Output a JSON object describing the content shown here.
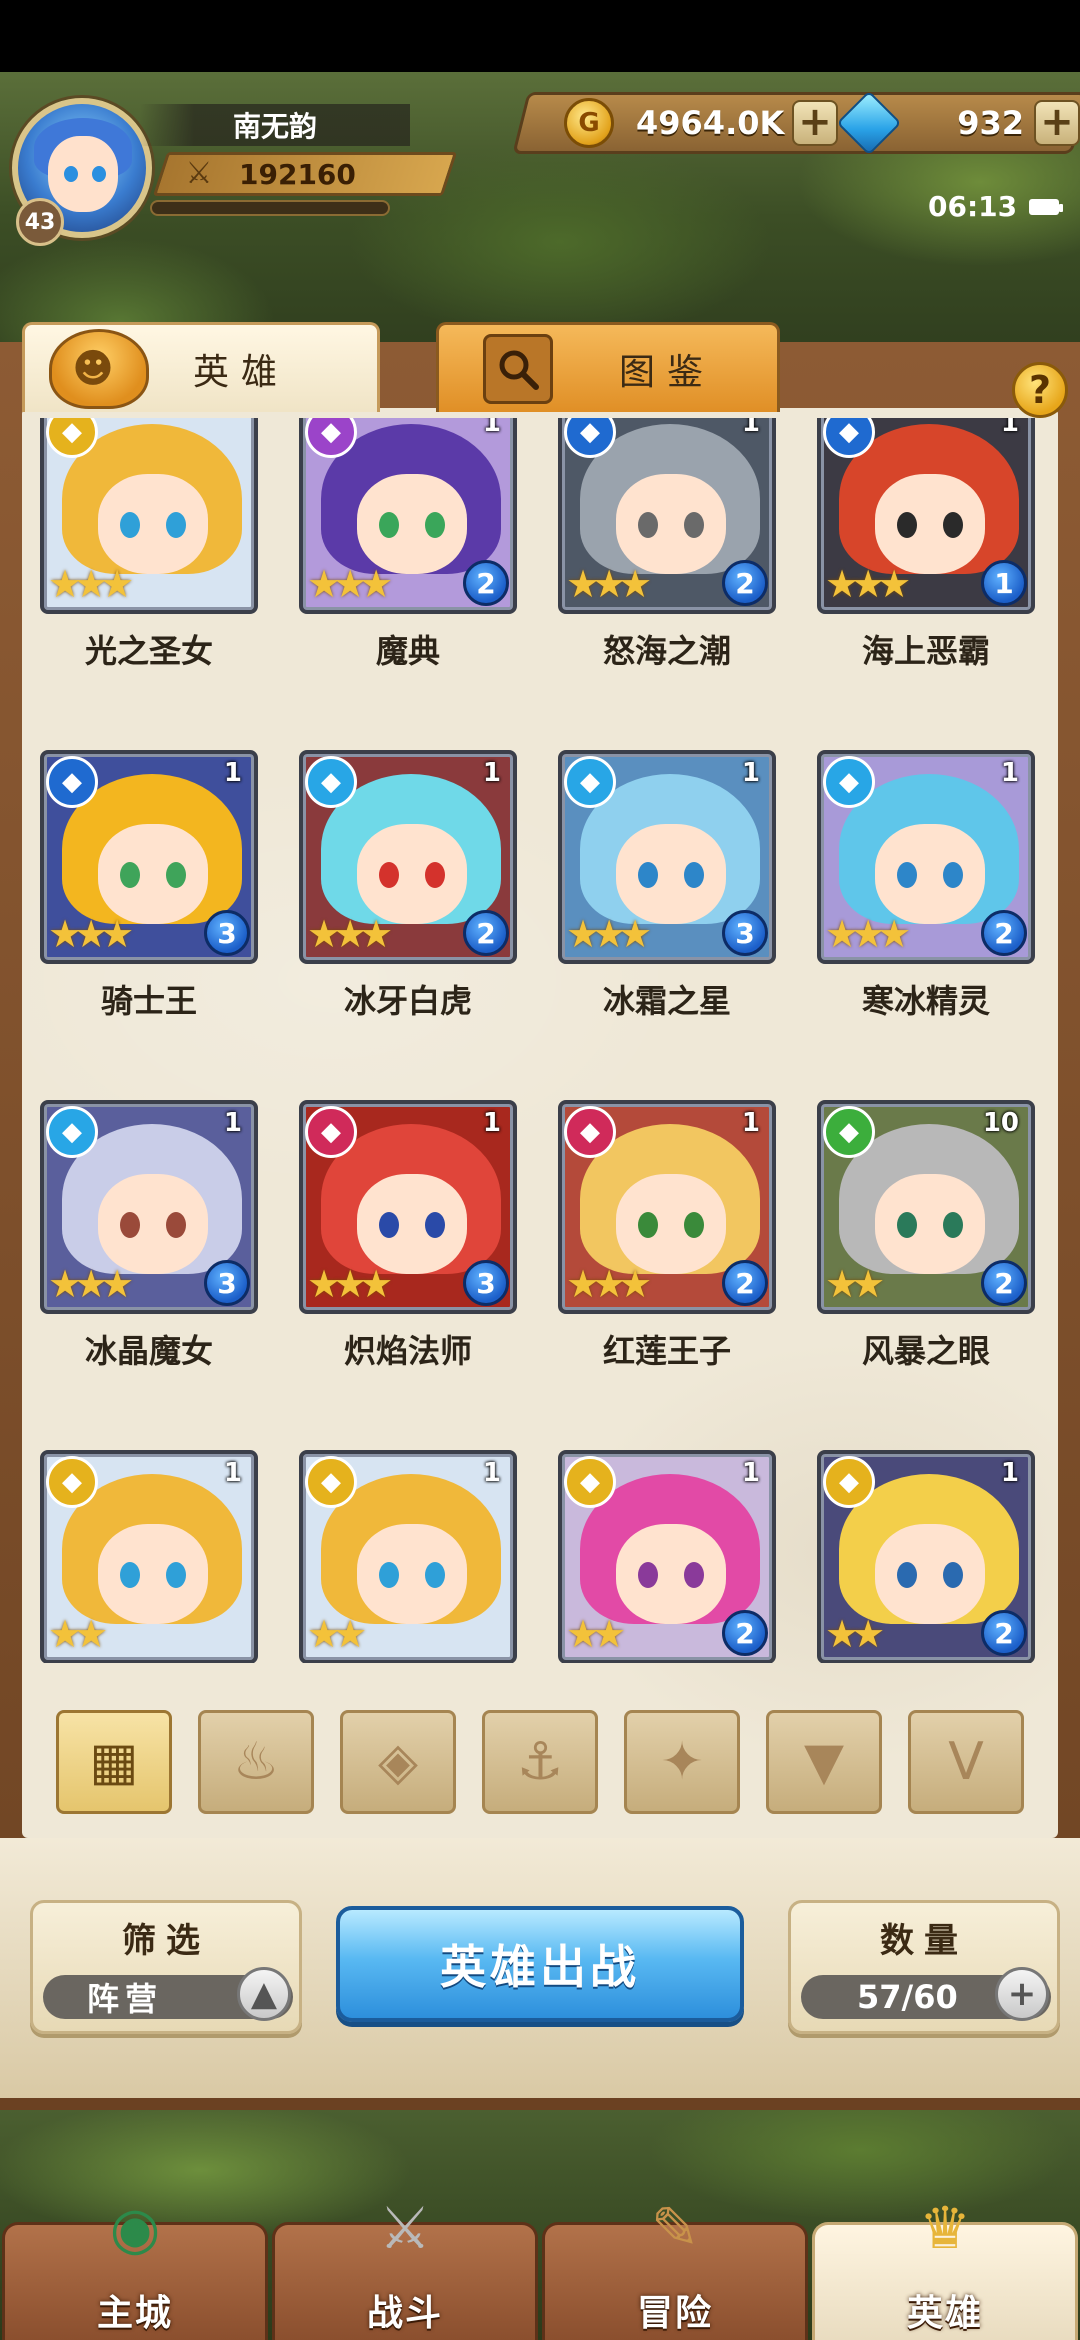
{
  "player": {
    "name": "南无韵",
    "level": "43",
    "power": "192160"
  },
  "currency": {
    "gold": "4964.0K",
    "gems": "932"
  },
  "status": {
    "time": "06:13"
  },
  "tabs": [
    {
      "label": "英雄",
      "active": true
    },
    {
      "label": "图鉴",
      "active": false
    }
  ],
  "help_label": "?",
  "heroes": [
    {
      "name": "光之圣女",
      "faction_color": "#e5b21d",
      "hair": "#f0b83a",
      "eye": "#2fa0d8",
      "bg": "#d7e4f2",
      "stars": 3,
      "count": "",
      "badge": ""
    },
    {
      "name": "魔典",
      "faction_color": "#9b44c9",
      "hair": "#5b3aa8",
      "eye": "#3aa65a",
      "bg": "#b39adb",
      "stars": 3,
      "count": "1",
      "badge": "2"
    },
    {
      "name": "怒海之潮",
      "faction_color": "#1f6ad0",
      "hair": "#9aa3ad",
      "eye": "#6a6a6a",
      "bg": "#4e5866",
      "stars": 3,
      "count": "1",
      "badge": "2"
    },
    {
      "name": "海上恶霸",
      "faction_color": "#1f6ad0",
      "hair": "#d7452a",
      "eye": "#2a2a2a",
      "bg": "#3c3a44",
      "stars": 3,
      "count": "1",
      "badge": "1"
    },
    {
      "name": "骑士王",
      "faction_color": "#1f6ad0",
      "hair": "#f3b61f",
      "eye": "#3fa45a",
      "bg": "#3f4f9c",
      "stars": 3,
      "count": "1",
      "badge": "3"
    },
    {
      "name": "冰牙白虎",
      "faction_color": "#28a6e6",
      "hair": "#6fd9e8",
      "eye": "#d4322c",
      "bg": "#8a3a3c",
      "stars": 3,
      "count": "1",
      "badge": "2"
    },
    {
      "name": "冰霜之星",
      "faction_color": "#28a6e6",
      "hair": "#8fd0ee",
      "eye": "#2d86c9",
      "bg": "#5a8fbf",
      "stars": 3,
      "count": "1",
      "badge": "3"
    },
    {
      "name": "寒冰精灵",
      "faction_color": "#28a6e6",
      "hair": "#5fc6ea",
      "eye": "#2d86c9",
      "bg": "#a89ad8",
      "stars": 3,
      "count": "1",
      "badge": "2"
    },
    {
      "name": "冰晶魔女",
      "faction_color": "#28a6e6",
      "hair": "#c9cde8",
      "eye": "#9a4a3a",
      "bg": "#5a5f9c",
      "stars": 3,
      "count": "1",
      "badge": "3"
    },
    {
      "name": "炽焰法师",
      "faction_color": "#d02a5a",
      "hair": "#e0453a",
      "eye": "#2a4aa8",
      "bg": "#a8281e",
      "stars": 3,
      "count": "1",
      "badge": "3"
    },
    {
      "name": "红莲王子",
      "faction_color": "#d02a5a",
      "hair": "#f2c660",
      "eye": "#3a8a3a",
      "bg": "#b44a3a",
      "stars": 3,
      "count": "1",
      "badge": "2"
    },
    {
      "name": "风暴之眼",
      "faction_color": "#3cae3c",
      "hair": "#b8b8b8",
      "eye": "#2a7a5a",
      "bg": "#6a7a4a",
      "stars": 2,
      "count": "10",
      "badge": "2"
    },
    {
      "name": "",
      "faction_color": "#e5b21d",
      "hair": "#f0b83a",
      "eye": "#2fa0d8",
      "bg": "#d7e4f2",
      "stars": 2,
      "count": "1",
      "badge": ""
    },
    {
      "name": "",
      "faction_color": "#e5b21d",
      "hair": "#f0b83a",
      "eye": "#2fa0d8",
      "bg": "#d7e4f2",
      "stars": 2,
      "count": "1",
      "badge": ""
    },
    {
      "name": "",
      "faction_color": "#e5b21d",
      "hair": "#e24aa6",
      "eye": "#8a3a9a",
      "bg": "#c9b9dc",
      "stars": 2,
      "count": "1",
      "badge": "2"
    },
    {
      "name": "",
      "faction_color": "#e5b21d",
      "hair": "#f3cf4a",
      "eye": "#2a6ab0",
      "bg": "#4a4a7a",
      "stars": 2,
      "count": "1",
      "badge": "2"
    }
  ],
  "filters": [
    {
      "icon": "grid-icon",
      "glyph": "▦",
      "active": true
    },
    {
      "icon": "fire-faction-icon",
      "glyph": "♨",
      "active": false
    },
    {
      "icon": "ice-faction-icon",
      "glyph": "◈",
      "active": false
    },
    {
      "icon": "anchor-faction-icon",
      "glyph": "⚓",
      "active": false
    },
    {
      "icon": "beast-faction-icon",
      "glyph": "✦",
      "active": false
    },
    {
      "icon": "dark-faction-icon",
      "glyph": "▼",
      "active": false
    },
    {
      "icon": "light-faction-icon",
      "glyph": "V",
      "active": false
    }
  ],
  "controls": {
    "filter_label": "筛选",
    "filter_value": "阵营",
    "deploy_label": "英雄出战",
    "count_label": "数量",
    "count_value": "57/60"
  },
  "nav": [
    {
      "label": "主城",
      "icon": "castle-icon",
      "glyph": "◉",
      "active": false
    },
    {
      "label": "战斗",
      "icon": "swords-icon",
      "glyph": "⚔",
      "active": false
    },
    {
      "label": "冒险",
      "icon": "map-scroll-icon",
      "glyph": "✎",
      "active": false
    },
    {
      "label": "英雄",
      "icon": "hero-crest-icon",
      "glyph": "♛",
      "active": true
    }
  ]
}
